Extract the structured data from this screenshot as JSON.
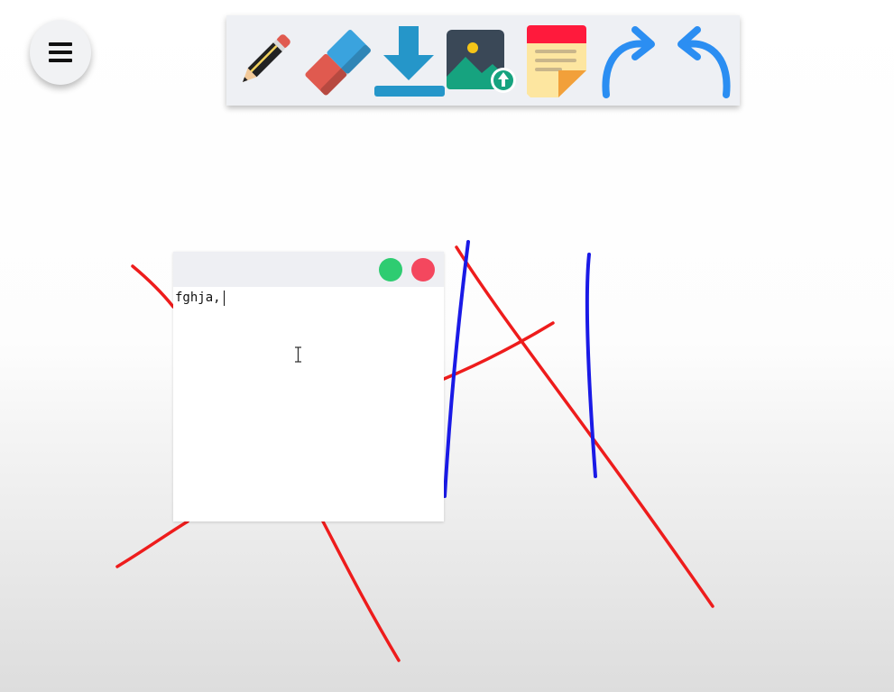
{
  "menu": {
    "icon": "hamburger-icon"
  },
  "toolbar": {
    "tools": [
      {
        "name": "pencil",
        "icon": "pencil-icon"
      },
      {
        "name": "eraser",
        "icon": "eraser-icon"
      },
      {
        "name": "download",
        "icon": "download-icon"
      },
      {
        "name": "upload-image",
        "icon": "image-upload-icon"
      },
      {
        "name": "sticky-note",
        "icon": "sticky-note-icon"
      },
      {
        "name": "redo",
        "icon": "redo-arrow-icon"
      },
      {
        "name": "undo",
        "icon": "undo-arrow-icon"
      }
    ]
  },
  "colors": {
    "toolbar_bg": "#eef0f4",
    "stroke_red": "#ee1c1c",
    "stroke_blue": "#1a1ae6",
    "note_green": "#2ecc71",
    "note_red": "#f4475e",
    "accent_blue": "#2b8ef2"
  },
  "note": {
    "text": "fghja,"
  }
}
